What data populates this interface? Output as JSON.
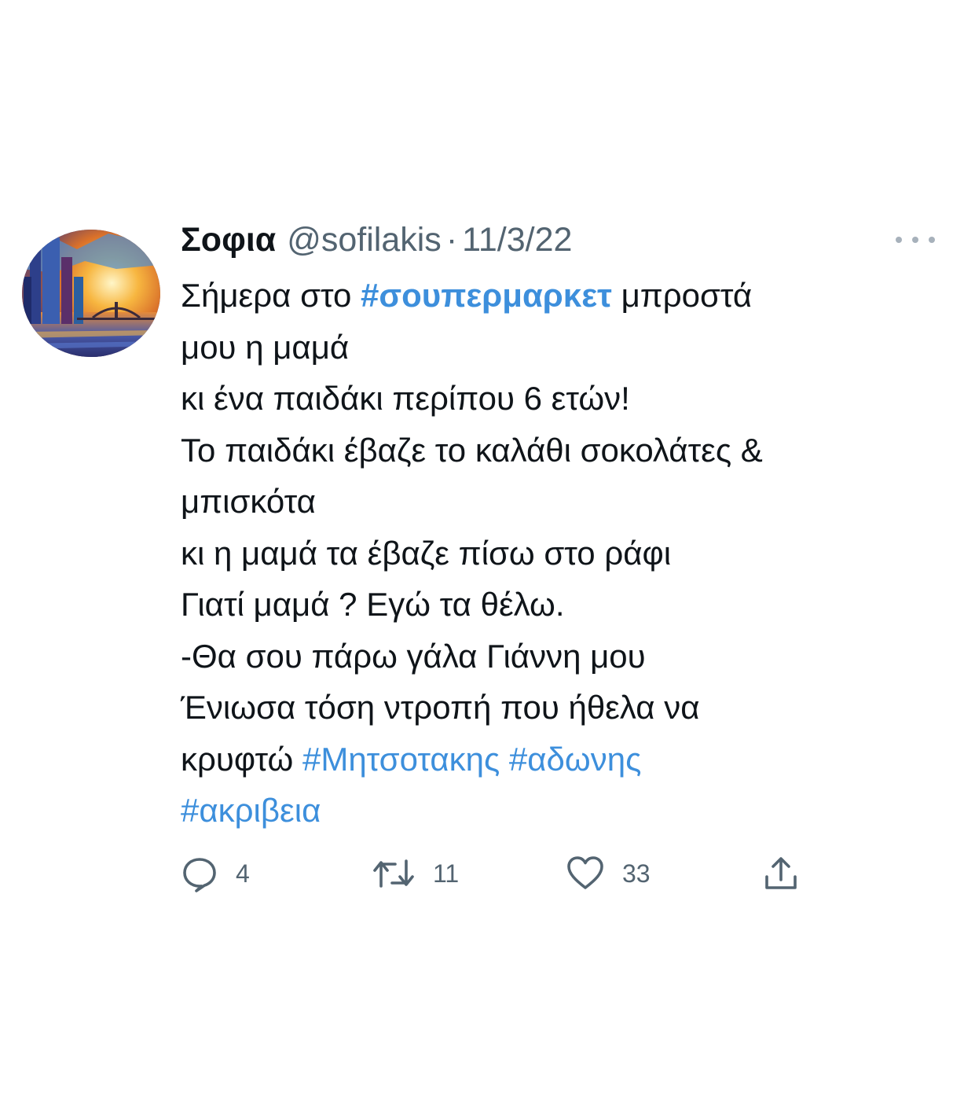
{
  "tweet": {
    "author_name": "Σοφια",
    "handle": "@sofilakis",
    "separator": "·",
    "date": "11/3/22",
    "body": {
      "l1_a": "Σήμερα στο ",
      "l1_tag": "#σουπερμαρκετ",
      "l1_b": " μπροστά",
      "l2": "μου η μαμά",
      "l3": "κι ένα παιδάκι περίπου 6 ετών!",
      "l4": "Το παιδάκι έβαζε το καλάθι σοκολάτες &",
      "l5": "μπισκότα",
      "l6": "κι η μαμά τα έβαζε πίσω στο ράφι",
      "l7": "Γιατί μαμά ? Εγώ τα θέλω.",
      "l8": "-Θα σου πάρω γάλα Γιάννη μου",
      "l9": "Ένιωσα τόση ντροπή που ήθελα να",
      "l10_a": "κρυφτώ ",
      "l10_tag1": "#Μητσοτακης",
      "l10_tag2": "#αδωνης",
      "l11_tag": "#ακριβεια"
    },
    "actions": {
      "reply_icon": "reply-icon",
      "reply_count": "4",
      "retweet_icon": "retweet-icon",
      "retweet_count": "11",
      "like_icon": "heart-icon",
      "like_count": "33",
      "share_icon": "share-icon"
    },
    "colors": {
      "hashtag": "#3d8fdc",
      "secondary_text": "#536471",
      "primary_text": "#0f1419"
    }
  }
}
